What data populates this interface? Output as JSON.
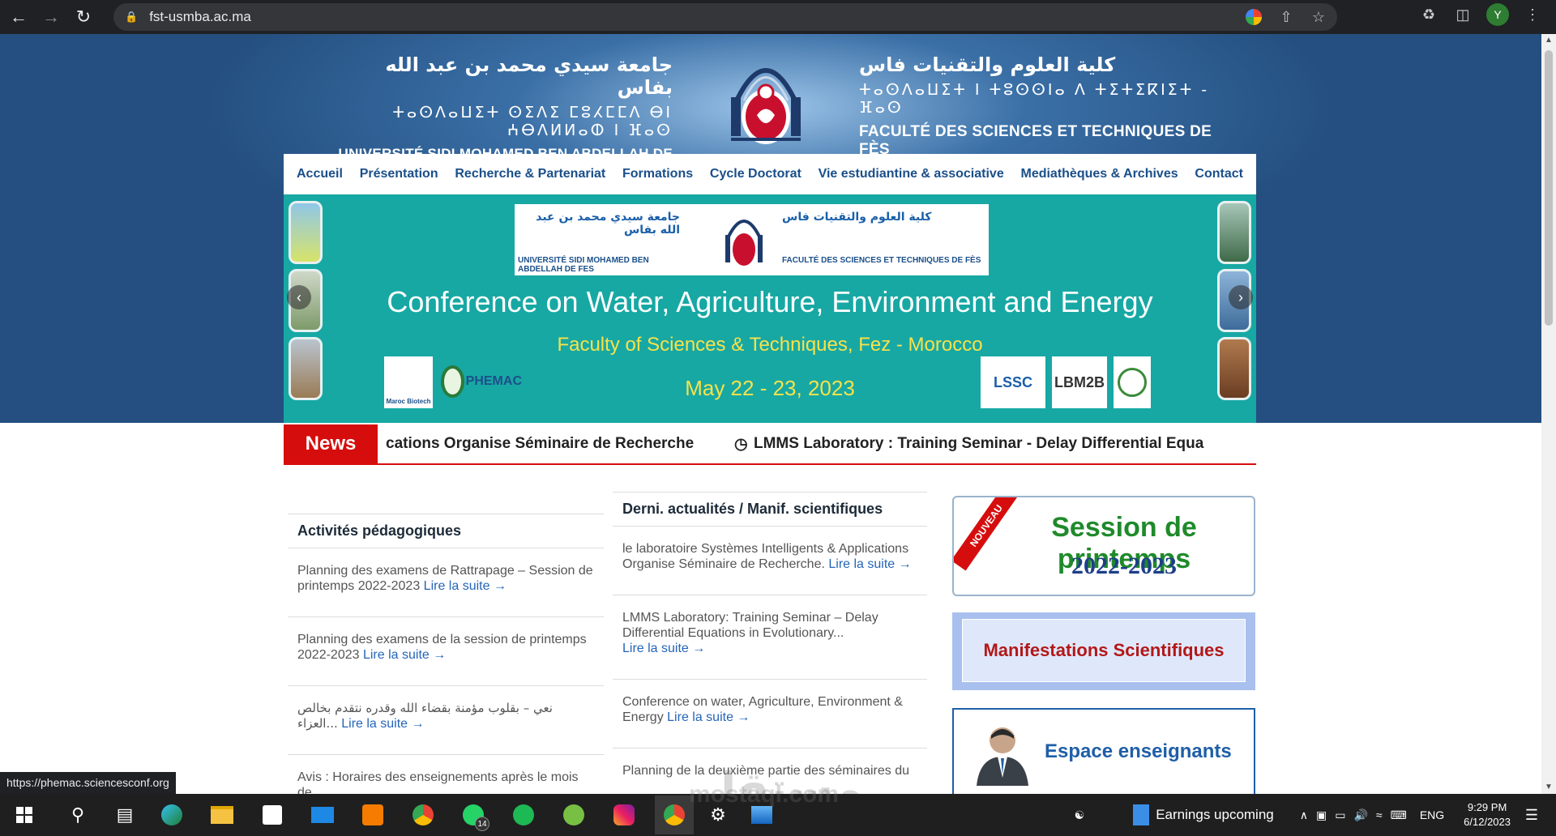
{
  "browser": {
    "url": "fst-usmba.ac.ma",
    "avatar_letter": "Y",
    "status_link": "https://phemac.sciencesconf.org"
  },
  "header": {
    "left_arabic": "جامعة سيدي محمد بن عبد الله بفاس",
    "left_tifinagh": "ⵜⴰⵙⴷⴰⵡⵉⵜ ⵙⵉⴷⵉ ⵎⵓⵃⵎⵎⴷ ⴱⵏ ⵄⴱⴷⵍⵍⴰⵀ ⵏ ⴼⴰⵙ",
    "left_latin": "UNIVERSITÉ SIDI MOHAMED BEN ABDELLAH DE FES",
    "right_arabic": "كلية العلوم والتقنيات فاس",
    "right_tifinagh": "ⵜⴰⵙⴷⴰⵡⵉⵜ ⵏ ⵜⵓⵙⵙⵏⴰ ⴷ ⵜⵉⵜⵉⴽⵏⵉⵜ - ⴼⴰⵙ",
    "right_latin": "FACULTÉ DES SCIENCES ET TECHNIQUES DE FÈS"
  },
  "menu": {
    "items": [
      "Accueil",
      "Présentation",
      "Recherche & Partenariat",
      "Formations",
      "Cycle Doctorat",
      "Vie estudiantine & associative",
      "Mediathèques & Archives",
      "Contact"
    ]
  },
  "banner": {
    "logo_left_arabic": "جامعة سيدي محمد بن عبد الله بفاس",
    "logo_left_latin": "UNIVERSITÉ SIDI MOHAMED BEN ABDELLAH DE FES",
    "logo_right_arabic": "كلية العلوم والتقنيات فاس",
    "logo_right_latin": "FACULTÉ DES SCIENCES ET TECHNIQUES DE FÈS",
    "title": "Conference on Water, Agriculture, Environment and Energy",
    "subtitle": "Faculty of Sciences & Techniques, Fez - Morocco",
    "date": "May 22 - 23, 2023",
    "sponsor_left_1": "Maroc Biotech",
    "sponsor_left_2": "PHEMAC",
    "sponsor_right_1": "LSSC",
    "sponsor_right_2": "LBM2B"
  },
  "news": {
    "label": "News",
    "item_1": "cations Organise Séminaire de Recherche",
    "item_2": "LMMS Laboratory : Training Seminar - Delay Differential Equa"
  },
  "activites": {
    "title": "Activités pédagogiques",
    "read_more": "Lire la suite →",
    "posts": [
      "Planning des examens de Rattrapage – Session de printemps 2022-2023",
      "Planning des examens de la session de printemps 2022-2023",
      "نعي – بقلوب مؤمنة بقضاء الله وقدره نتقدم بخالص العزاء...",
      "Avis : Horaires des enseignements après le mois de"
    ]
  },
  "actualites": {
    "title": "Derni. actualités / Manif. scientifiques",
    "read_more": "Lire la suite →",
    "posts": [
      "le laboratoire Systèmes Intelligents & Applications Organise Séminaire de Recherche.",
      "LMMS Laboratory: Training Seminar – Delay Differential Equations in Evolutionary...",
      "Conference on water, Agriculture, Environment & Energy",
      "Planning de la deuxième partie des séminaires du"
    ]
  },
  "sidebar": {
    "ribbon": "NOUVEAU",
    "session_title": "Session de printemps",
    "session_year": "2022-2023",
    "manifestations": "Manifestations Scientifiques",
    "enseignants": "Espace enseignants"
  },
  "taskbar": {
    "earnings": "Earnings upcoming",
    "lang": "ENG",
    "time": "9:29 PM",
    "date": "6/12/2023",
    "whatsapp_badge": "14"
  },
  "watermark": {
    "arabic": "مستقل",
    "latin": "mostaql.com"
  },
  "colors": {
    "header_blue": "#244f80",
    "banner_teal": "#17a8a4",
    "news_red": "#d60d0d",
    "link_blue": "#2565b8",
    "menu_blue": "#1a4f8a"
  }
}
